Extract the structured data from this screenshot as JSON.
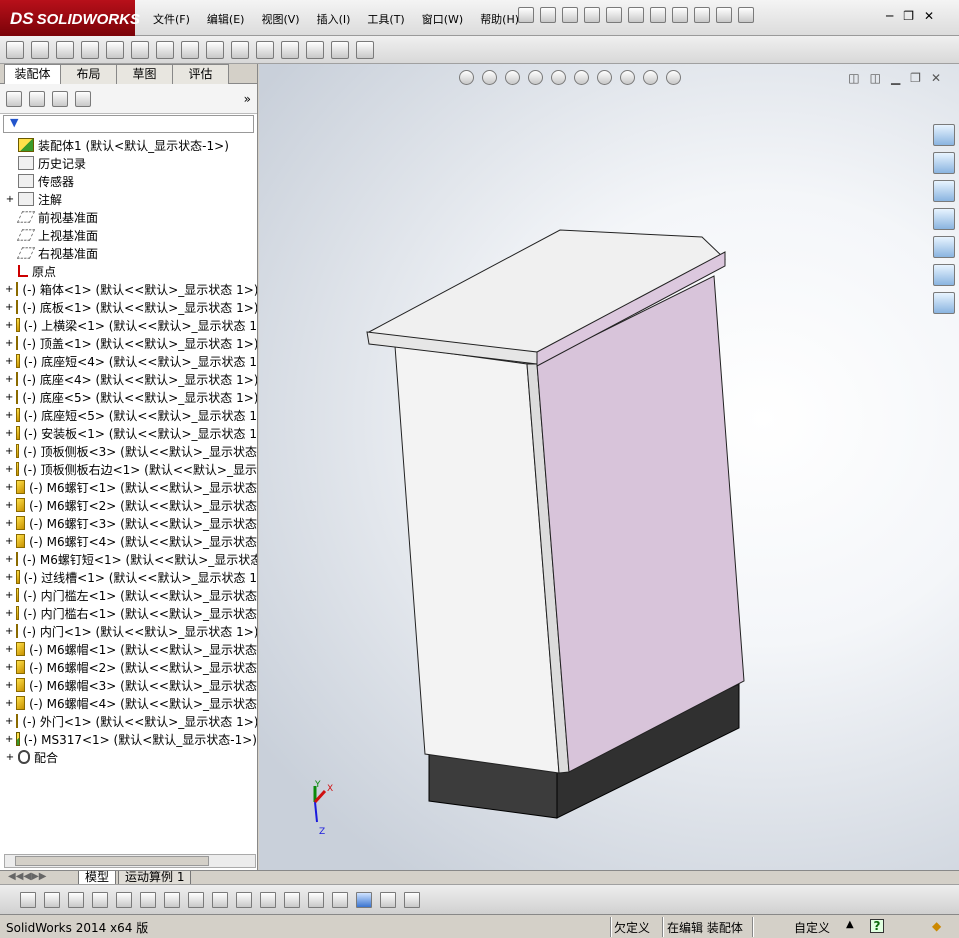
{
  "app": {
    "brand_prefix": "DS",
    "brand": "SOLIDWORKS"
  },
  "menu": [
    "文件(F)",
    "编辑(E)",
    "视图(V)",
    "插入(I)",
    "工具(T)",
    "窗口(W)",
    "帮助(H)"
  ],
  "tabs": [
    "装配体",
    "布局",
    "草图",
    "评估"
  ],
  "tree": [
    {
      "t": "装配体1 (默认<默认_显示状态-1>)",
      "icon": "asm",
      "exp": ""
    },
    {
      "t": "历史记录",
      "icon": "folder",
      "exp": ""
    },
    {
      "t": "传感器",
      "icon": "folder",
      "exp": ""
    },
    {
      "t": "注解",
      "icon": "folder",
      "exp": "+"
    },
    {
      "t": "前视基准面",
      "icon": "plane",
      "exp": ""
    },
    {
      "t": "上视基准面",
      "icon": "plane",
      "exp": ""
    },
    {
      "t": "右视基准面",
      "icon": "plane",
      "exp": ""
    },
    {
      "t": "原点",
      "icon": "origin",
      "exp": ""
    },
    {
      "t": "(-) 箱体<1> (默认<<默认>_显示状态 1>)",
      "icon": "part",
      "exp": "+"
    },
    {
      "t": "(-) 底板<1> (默认<<默认>_显示状态 1>)",
      "icon": "part",
      "exp": "+"
    },
    {
      "t": "(-) 上横梁<1> (默认<<默认>_显示状态 1",
      "icon": "part",
      "exp": "+"
    },
    {
      "t": "(-) 顶盖<1> (默认<<默认>_显示状态 1>)",
      "icon": "part",
      "exp": "+"
    },
    {
      "t": "(-) 底座短<4> (默认<<默认>_显示状态 1",
      "icon": "part",
      "exp": "+"
    },
    {
      "t": "(-) 底座<4> (默认<<默认>_显示状态 1>)",
      "icon": "part",
      "exp": "+"
    },
    {
      "t": "(-) 底座<5> (默认<<默认>_显示状态 1>)",
      "icon": "part",
      "exp": "+"
    },
    {
      "t": "(-) 底座短<5> (默认<<默认>_显示状态 1",
      "icon": "part",
      "exp": "+"
    },
    {
      "t": "(-) 安装板<1> (默认<<默认>_显示状态 1",
      "icon": "part",
      "exp": "+"
    },
    {
      "t": "(-) 顶板侧板<3> (默认<<默认>_显示状态",
      "icon": "part",
      "exp": "+"
    },
    {
      "t": "(-) 顶板侧板右边<1> (默认<<默认>_显示",
      "icon": "part",
      "exp": "+"
    },
    {
      "t": "(-) M6螺钉<1> (默认<<默认>_显示状态",
      "icon": "part",
      "exp": "+"
    },
    {
      "t": "(-) M6螺钉<2> (默认<<默认>_显示状态",
      "icon": "part",
      "exp": "+"
    },
    {
      "t": "(-) M6螺钉<3> (默认<<默认>_显示状态",
      "icon": "part",
      "exp": "+"
    },
    {
      "t": "(-) M6螺钉<4> (默认<<默认>_显示状态",
      "icon": "part",
      "exp": "+"
    },
    {
      "t": "(-) M6螺钉短<1> (默认<<默认>_显示状态",
      "icon": "part",
      "exp": "+"
    },
    {
      "t": "(-) 过线槽<1> (默认<<默认>_显示状态 1",
      "icon": "part",
      "exp": "+"
    },
    {
      "t": "(-) 内门槛左<1> (默认<<默认>_显示状态",
      "icon": "part",
      "exp": "+"
    },
    {
      "t": "(-) 内门槛右<1> (默认<<默认>_显示状态",
      "icon": "part",
      "exp": "+"
    },
    {
      "t": "(-) 内门<1> (默认<<默认>_显示状态 1>)",
      "icon": "part",
      "exp": "+"
    },
    {
      "t": "(-) M6螺帽<1> (默认<<默认>_显示状态",
      "icon": "part",
      "exp": "+"
    },
    {
      "t": "(-) M6螺帽<2> (默认<<默认>_显示状态",
      "icon": "part",
      "exp": "+"
    },
    {
      "t": "(-) M6螺帽<3> (默认<<默认>_显示状态",
      "icon": "part",
      "exp": "+"
    },
    {
      "t": "(-) M6螺帽<4> (默认<<默认>_显示状态",
      "icon": "part",
      "exp": "+"
    },
    {
      "t": "(-) 外门<1> (默认<<默认>_显示状态 1>)",
      "icon": "part",
      "exp": "+"
    },
    {
      "t": "(-) MS317<1> (默认<默认_显示状态-1>)",
      "icon": "asm",
      "exp": "+"
    },
    {
      "t": "配合",
      "icon": "mate",
      "exp": "+"
    }
  ],
  "bottom_tabs": [
    "模型",
    "运动算例 1"
  ],
  "status": {
    "version": "SolidWorks 2014 x64 版",
    "undefined": "欠定义",
    "editing": "在编辑 装配体",
    "custom": "自定义",
    "help": "?"
  },
  "triad": {
    "x": "X",
    "y": "Y",
    "z": "Z"
  },
  "colors": {
    "door": "#d8c4da",
    "cabinet": "#f2f2f2",
    "base": "#3a3a3a"
  }
}
